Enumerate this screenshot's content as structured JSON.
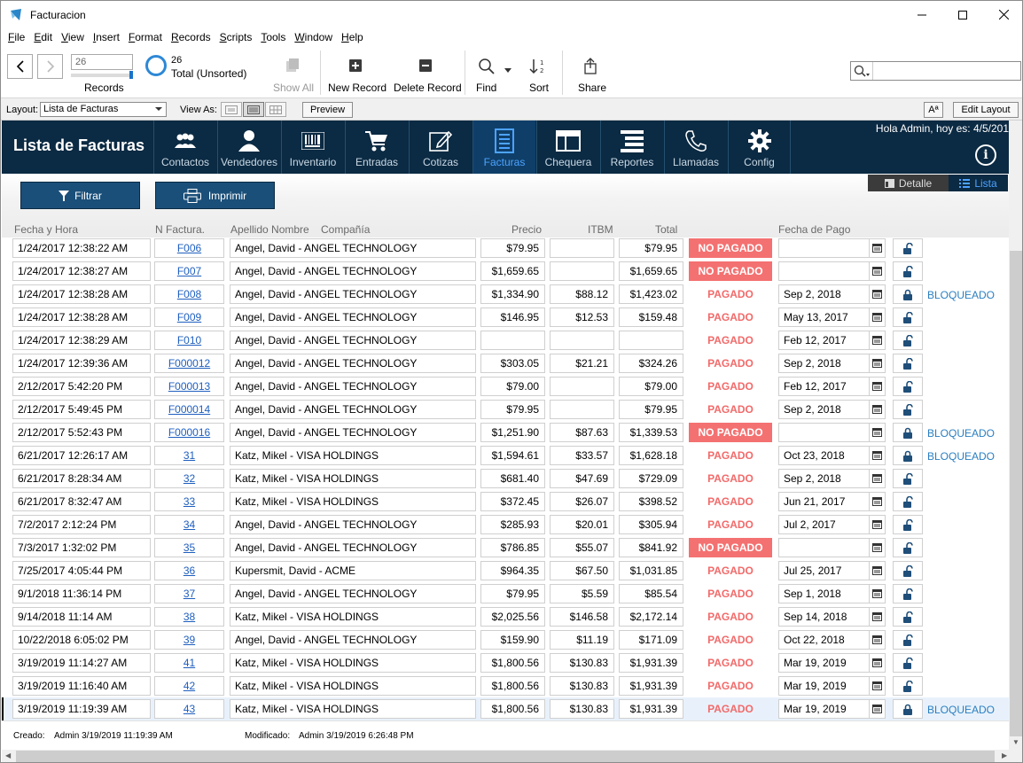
{
  "window": {
    "title": "Facturacion"
  },
  "menu": [
    "File",
    "Edit",
    "View",
    "Insert",
    "Format",
    "Records",
    "Scripts",
    "Tools",
    "Window",
    "Help"
  ],
  "toolbar": {
    "record_number": "26",
    "records_label": "Records",
    "total_count": "26",
    "total_label": "Total (Unsorted)",
    "show_all": "Show All",
    "new_record": "New Record",
    "delete_record": "Delete Record",
    "find": "Find",
    "sort": "Sort",
    "share": "Share"
  },
  "layoutbar": {
    "layout_label": "Layout:",
    "layout_value": "Lista de Facturas",
    "view_as_label": "View As:",
    "preview": "Preview",
    "text_size": "Aª",
    "edit_layout": "Edit Layout"
  },
  "header": {
    "page_title": "Lista de Facturas",
    "greeting": "Hola Admin, hoy es: 4/5/201",
    "tabs": [
      {
        "label": "Contactos",
        "icon": "contacts-icon"
      },
      {
        "label": "Vendedores",
        "icon": "person-icon"
      },
      {
        "label": "Inventario",
        "icon": "barcode-icon"
      },
      {
        "label": "Entradas",
        "icon": "cart-icon"
      },
      {
        "label": "Cotizas",
        "icon": "edit-icon"
      },
      {
        "label": "Facturas",
        "icon": "document-icon"
      },
      {
        "label": "Chequera",
        "icon": "checkbook-icon"
      },
      {
        "label": "Reportes",
        "icon": "reports-icon"
      },
      {
        "label": "Llamadas",
        "icon": "phone-icon"
      },
      {
        "label": "Config",
        "icon": "gear-icon"
      }
    ]
  },
  "actions": {
    "filter": "Filtrar",
    "print": "Imprimir",
    "detail": "Detalle",
    "list": "Lista"
  },
  "columns": {
    "fecha": "Fecha y Hora",
    "factura": "N Factura.",
    "apellido": "Apellido Nombre",
    "compania": "Compañía",
    "precio": "Precio",
    "itbm": "ITBM",
    "total": "Total",
    "pago": "Fecha de Pago"
  },
  "rows": [
    {
      "date": "1/24/2017 12:38:22 AM",
      "num": "F006",
      "name": "Angel, David - ANGEL TECHNOLOGY",
      "precio": "$79.95",
      "itbm": "",
      "total": "$79.95",
      "status": "NO PAGADO",
      "paid": false,
      "pago": "",
      "locked": false,
      "bloq": ""
    },
    {
      "date": "1/24/2017 12:38:27 AM",
      "num": "F007",
      "name": "Angel, David - ANGEL TECHNOLOGY",
      "precio": "$1,659.65",
      "itbm": "",
      "total": "$1,659.65",
      "status": "NO PAGADO",
      "paid": false,
      "pago": "",
      "locked": false,
      "bloq": ""
    },
    {
      "date": "1/24/2017 12:38:28 AM",
      "num": "F008",
      "name": "Angel, David - ANGEL TECHNOLOGY",
      "precio": "$1,334.90",
      "itbm": "$88.12",
      "total": "$1,423.02",
      "status": "PAGADO",
      "paid": true,
      "pago": "Sep 2, 2018",
      "locked": true,
      "bloq": "BLOQUEADO"
    },
    {
      "date": "1/24/2017 12:38:28 AM",
      "num": "F009",
      "name": "Angel, David - ANGEL TECHNOLOGY",
      "precio": "$146.95",
      "itbm": "$12.53",
      "total": "$159.48",
      "status": "PAGADO",
      "paid": true,
      "pago": "May 13, 2017",
      "locked": false,
      "bloq": ""
    },
    {
      "date": "1/24/2017 12:38:29 AM",
      "num": "F010",
      "name": "Angel, David - ANGEL TECHNOLOGY",
      "precio": "",
      "itbm": "",
      "total": "",
      "status": "PAGADO",
      "paid": true,
      "pago": "Feb 12, 2017",
      "locked": false,
      "bloq": ""
    },
    {
      "date": "1/24/2017 12:39:36 AM",
      "num": "F000012",
      "name": "Angel, David - ANGEL TECHNOLOGY",
      "precio": "$303.05",
      "itbm": "$21.21",
      "total": "$324.26",
      "status": "PAGADO",
      "paid": true,
      "pago": "Sep 2, 2018",
      "locked": false,
      "bloq": ""
    },
    {
      "date": "2/12/2017 5:42:20 PM",
      "num": "F000013",
      "name": "Angel, David - ANGEL TECHNOLOGY",
      "precio": "$79.00",
      "itbm": "",
      "total": "$79.00",
      "status": "PAGADO",
      "paid": true,
      "pago": "Feb 12, 2017",
      "locked": false,
      "bloq": ""
    },
    {
      "date": "2/12/2017 5:49:45 PM",
      "num": "F000014",
      "name": "Angel, David - ANGEL TECHNOLOGY",
      "precio": "$79.95",
      "itbm": "",
      "total": "$79.95",
      "status": "PAGADO",
      "paid": true,
      "pago": "Sep 2, 2018",
      "locked": false,
      "bloq": ""
    },
    {
      "date": "2/12/2017 5:52:43 PM",
      "num": "F000016",
      "name": "Angel, David - ANGEL TECHNOLOGY",
      "precio": "$1,251.90",
      "itbm": "$87.63",
      "total": "$1,339.53",
      "status": "NO PAGADO",
      "paid": false,
      "pago": "",
      "locked": true,
      "bloq": "BLOQUEADO"
    },
    {
      "date": "6/21/2017 12:26:17 AM",
      "num": "31",
      "name": "Katz, Mikel - VISA HOLDINGS",
      "precio": "$1,594.61",
      "itbm": "$33.57",
      "total": "$1,628.18",
      "status": "PAGADO",
      "paid": true,
      "pago": "Oct 23, 2018",
      "locked": true,
      "bloq": "BLOQUEADO"
    },
    {
      "date": "6/21/2017 8:28:34 AM",
      "num": "32",
      "name": "Katz, Mikel - VISA HOLDINGS",
      "precio": "$681.40",
      "itbm": "$47.69",
      "total": "$729.09",
      "status": "PAGADO",
      "paid": true,
      "pago": "Sep 2, 2018",
      "locked": false,
      "bloq": ""
    },
    {
      "date": "6/21/2017 8:32:47 AM",
      "num": "33",
      "name": "Katz, Mikel - VISA HOLDINGS",
      "precio": "$372.45",
      "itbm": "$26.07",
      "total": "$398.52",
      "status": "PAGADO",
      "paid": true,
      "pago": "Jun 21, 2017",
      "locked": false,
      "bloq": ""
    },
    {
      "date": "7/2/2017 2:12:24 PM",
      "num": "34",
      "name": "Angel, David - ANGEL TECHNOLOGY",
      "precio": "$285.93",
      "itbm": "$20.01",
      "total": "$305.94",
      "status": "PAGADO",
      "paid": true,
      "pago": "Jul 2, 2017",
      "locked": false,
      "bloq": ""
    },
    {
      "date": "7/3/2017 1:32:02 PM",
      "num": "35",
      "name": "Angel, David - ANGEL TECHNOLOGY",
      "precio": "$786.85",
      "itbm": "$55.07",
      "total": "$841.92",
      "status": "NO PAGADO",
      "paid": false,
      "pago": "",
      "locked": false,
      "bloq": ""
    },
    {
      "date": "7/25/2017 4:05:44 PM",
      "num": "36",
      "name": "Kupersmit, David - ACME",
      "precio": "$964.35",
      "itbm": "$67.50",
      "total": "$1,031.85",
      "status": "PAGADO",
      "paid": true,
      "pago": "Jul 25, 2017",
      "locked": false,
      "bloq": ""
    },
    {
      "date": "9/1/2018 11:36:14 PM",
      "num": "37",
      "name": "Angel, David - ANGEL TECHNOLOGY",
      "precio": "$79.95",
      "itbm": "$5.59",
      "total": "$85.54",
      "status": "PAGADO",
      "paid": true,
      "pago": "Sep 1, 2018",
      "locked": false,
      "bloq": ""
    },
    {
      "date": "9/14/2018 11:14 AM",
      "num": "38",
      "name": "Katz, Mikel - VISA HOLDINGS",
      "precio": "$2,025.56",
      "itbm": "$146.58",
      "total": "$2,172.14",
      "status": "PAGADO",
      "paid": true,
      "pago": "Sep 14, 2018",
      "locked": false,
      "bloq": ""
    },
    {
      "date": "10/22/2018 6:05:02 PM",
      "num": "39",
      "name": "Angel, David - ANGEL TECHNOLOGY",
      "precio": "$159.90",
      "itbm": "$11.19",
      "total": "$171.09",
      "status": "PAGADO",
      "paid": true,
      "pago": "Oct 22, 2018",
      "locked": false,
      "bloq": ""
    },
    {
      "date": "3/19/2019 11:14:27 AM",
      "num": "41",
      "name": "Katz, Mikel - VISA HOLDINGS",
      "precio": "$1,800.56",
      "itbm": "$130.83",
      "total": "$1,931.39",
      "status": "PAGADO",
      "paid": true,
      "pago": "Mar 19, 2019",
      "locked": false,
      "bloq": ""
    },
    {
      "date": "3/19/2019 11:16:40 AM",
      "num": "42",
      "name": "Katz, Mikel - VISA HOLDINGS",
      "precio": "$1,800.56",
      "itbm": "$130.83",
      "total": "$1,931.39",
      "status": "PAGADO",
      "paid": true,
      "pago": "Mar 19, 2019",
      "locked": false,
      "bloq": ""
    },
    {
      "date": "3/19/2019 11:19:39 AM",
      "num": "43",
      "name": "Katz, Mikel - VISA HOLDINGS",
      "precio": "$1,800.56",
      "itbm": "$130.83",
      "total": "$1,931.39",
      "status": "PAGADO",
      "paid": true,
      "pago": "Mar 19, 2019",
      "locked": true,
      "bloq": "BLOQUEADO",
      "selected": true
    }
  ],
  "footer": {
    "created_label": "Creado:",
    "created_value": "Admin  3/19/2019 11:19:39 AM",
    "modified_label": "Modificado:",
    "modified_value": "Admin  3/19/2019 6:26:48 PM"
  },
  "colors": {
    "header_bg": "#0b2a43",
    "accent_blue": "#4da3ff",
    "status_unpaid_bg": "#f47171",
    "status_paid_text": "#f26a6a",
    "link_blue": "#1f5fbf",
    "locked_text": "#2a7fc1"
  }
}
